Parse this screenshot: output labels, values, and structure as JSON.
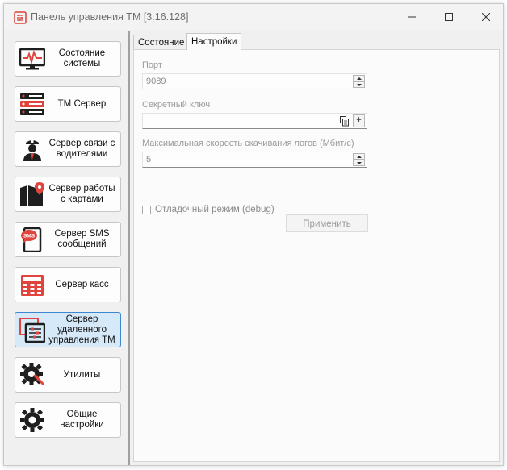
{
  "window": {
    "title": "Панель управления ТМ [3.16.128]"
  },
  "sidebar": {
    "items": [
      {
        "label": "Состояние системы",
        "icon": "monitor-pulse-icon",
        "active": false
      },
      {
        "label": "ТМ Сервер",
        "icon": "server-rack-icon",
        "active": false
      },
      {
        "label": "Сервер связи с водителями",
        "icon": "driver-icon",
        "active": false
      },
      {
        "label": "Сервер работы с картами",
        "icon": "map-pin-icon",
        "active": false
      },
      {
        "label": "Сервер SMS сообщений",
        "icon": "sms-phone-icon",
        "active": false
      },
      {
        "label": "Сервер касс",
        "icon": "cash-register-icon",
        "active": false
      },
      {
        "label": "Сервер удаленного управления ТМ",
        "icon": "remote-control-icon",
        "active": true
      },
      {
        "label": "Утилиты",
        "icon": "wrench-gear-icon",
        "active": false
      },
      {
        "label": "Общие настройки",
        "icon": "gear-icon",
        "active": false
      }
    ]
  },
  "tabs": [
    {
      "label": "Состояние",
      "active": false
    },
    {
      "label": "Настройки",
      "active": true
    }
  ],
  "settings": {
    "port_label": "Порт",
    "port_value": "9089",
    "secret_label": "Секретный ключ",
    "secret_value": "",
    "speed_label": "Максимальная скорость скачивания логов (Мбит/с)",
    "speed_value": "5",
    "debug_label": "Отладочный режим (debug)",
    "debug_checked": false,
    "plus_label": "+",
    "apply_label": "Применить"
  },
  "colors": {
    "accent": "#3c88d0",
    "icon_red": "#e0443c",
    "icon_dark": "#1e1e1e",
    "active_bg": "#d6e9f8"
  }
}
